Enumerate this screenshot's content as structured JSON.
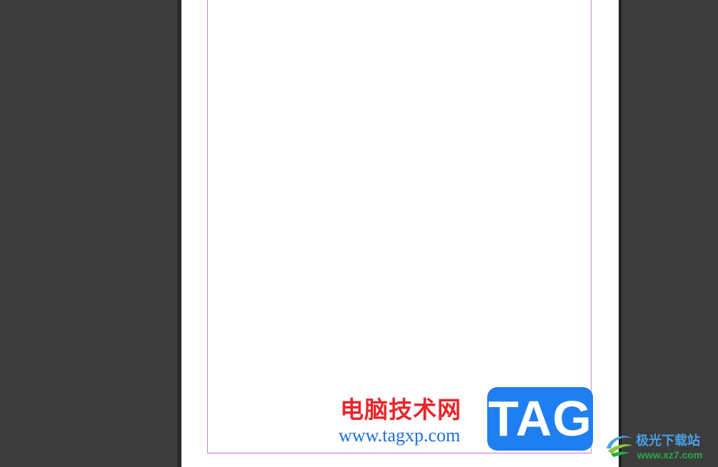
{
  "watermark": {
    "site_name_cn": "电脑技术网",
    "site_url": "www.tagxp.com",
    "tag_label": "TAG"
  },
  "watermark2": {
    "site_name_cn": "极光下载站",
    "site_url": "www.xz7.com",
    "logo_icon": "aurora-swirl-icon"
  },
  "colors": {
    "workspace_bg": "#3c3c3c",
    "page_bg": "#ffffff",
    "margin_guide": "#b48ed6",
    "tag_blue": "#1f7ff0",
    "cn_red": "#e8262b",
    "url_blue": "#1e6fdc"
  }
}
